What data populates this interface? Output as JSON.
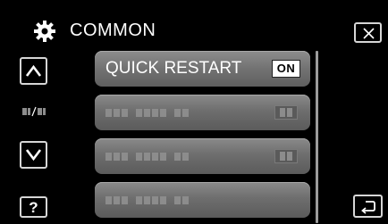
{
  "header": {
    "title": "COMMON",
    "icon": "gear-icon"
  },
  "buttons": {
    "close_icon": "close-icon",
    "up_icon": "chevron-up-icon",
    "down_icon": "chevron-down-icon",
    "help_label": "?",
    "back_icon": "return-icon"
  },
  "menu": {
    "items": [
      {
        "label": "QUICK RESTART",
        "value": "ON",
        "state": "selectable"
      },
      {
        "label": "",
        "value": "",
        "state": "greyed-placeholder"
      },
      {
        "label": "",
        "value": "",
        "state": "greyed-placeholder"
      },
      {
        "label": "",
        "value": "",
        "state": "greyed-placeholder"
      }
    ]
  },
  "colors": {
    "background": "#000000",
    "item_fill": "#6e6e6e",
    "button_border": "#d6d6d6",
    "badge_fill": "#ffffff",
    "placeholder": "#8c8c8c"
  }
}
